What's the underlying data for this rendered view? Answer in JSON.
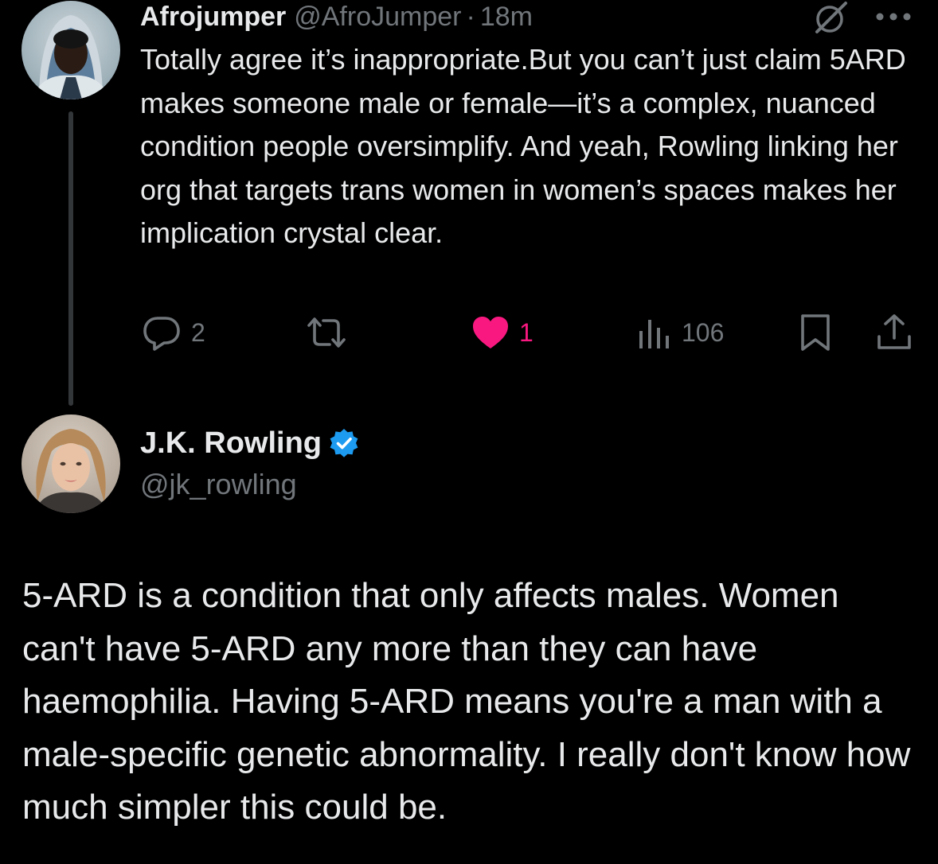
{
  "reply_tweet": {
    "author": {
      "display_name": "Afrojumper",
      "handle": "@AfroJumper",
      "separator": "·",
      "time": "18m",
      "avatar_icon": "avatar-person-hood"
    },
    "text": "Totally agree it’s inappropriate.But you can’t just claim 5ARD makes someone male or female—it’s a complex, nuanced condition people oversimplify. And yeah, Rowling linking her org that targets trans women in women’s spaces makes her implication crystal clear.",
    "actions": {
      "replies": "2",
      "reposts": "",
      "likes": "1",
      "views": "106"
    },
    "icons": {
      "grok": "grok-icon",
      "more": "more-icon",
      "reply": "reply-icon",
      "repost": "repost-icon",
      "like": "heart-icon",
      "views": "views-icon",
      "bookmark": "bookmark-icon",
      "share": "share-icon"
    },
    "liked": true
  },
  "main_tweet": {
    "author": {
      "display_name": "J.K. Rowling",
      "handle": "@jk_rowling",
      "verified": true,
      "avatar_icon": "avatar-person"
    },
    "text": "5-ARD is a condition that only affects males. Women can't have 5-ARD any more than they can have haemophilia. Having 5-ARD means you're a man with a male-specific genetic abnormality. I really don't know how much simpler this could be."
  },
  "colors": {
    "background": "#000000",
    "text_primary": "#e7e9ea",
    "text_secondary": "#71767b",
    "like_pink": "#f91880",
    "verified_blue": "#1d9bf0",
    "thread_line": "#333639"
  }
}
